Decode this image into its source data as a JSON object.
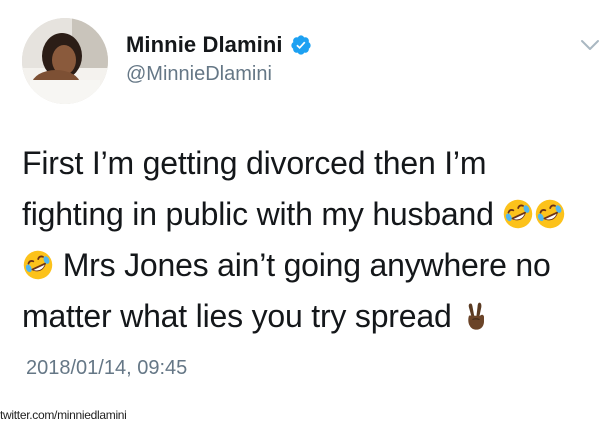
{
  "tweet": {
    "display_name": "Minnie Dlamini",
    "handle": "@MinnieDlamini",
    "verified": true,
    "text_lines": [
      {
        "parts": [
          "First I’m getting divorced then I’m"
        ]
      },
      {
        "parts": [
          "fighting in public with my husband "
        ],
        "trailing_emojis": [
          "rofl-emoji",
          "rofl-emoji"
        ]
      },
      {
        "leading_emoji": "rofl-emoji",
        "parts": [
          " Mrs Jones ain’t going anywhere no"
        ]
      },
      {
        "parts": [
          "matter what lies you try spread "
        ],
        "trailing_emojis": [
          "victory-hand-emoji"
        ]
      }
    ],
    "line1": "First I’m getting divorced then I’m",
    "line2": "fighting in public with my husband ",
    "line3": " Mrs Jones ain’t going anywhere no",
    "line4": "matter what lies you try spread ",
    "timestamp": "2018/01/14, 09:45"
  },
  "footer": {
    "source": "twitter.com/minniedlamini"
  },
  "colors": {
    "text": "#14171a",
    "secondary": "#657786",
    "verified_blue": "#1da1f2",
    "caret": "#aab8c2"
  },
  "icons": {
    "verified": "verified-badge-icon",
    "menu": "chevron-down-icon",
    "emoji_laugh": "rofl-emoji",
    "emoji_peace": "victory-hand-emoji"
  }
}
